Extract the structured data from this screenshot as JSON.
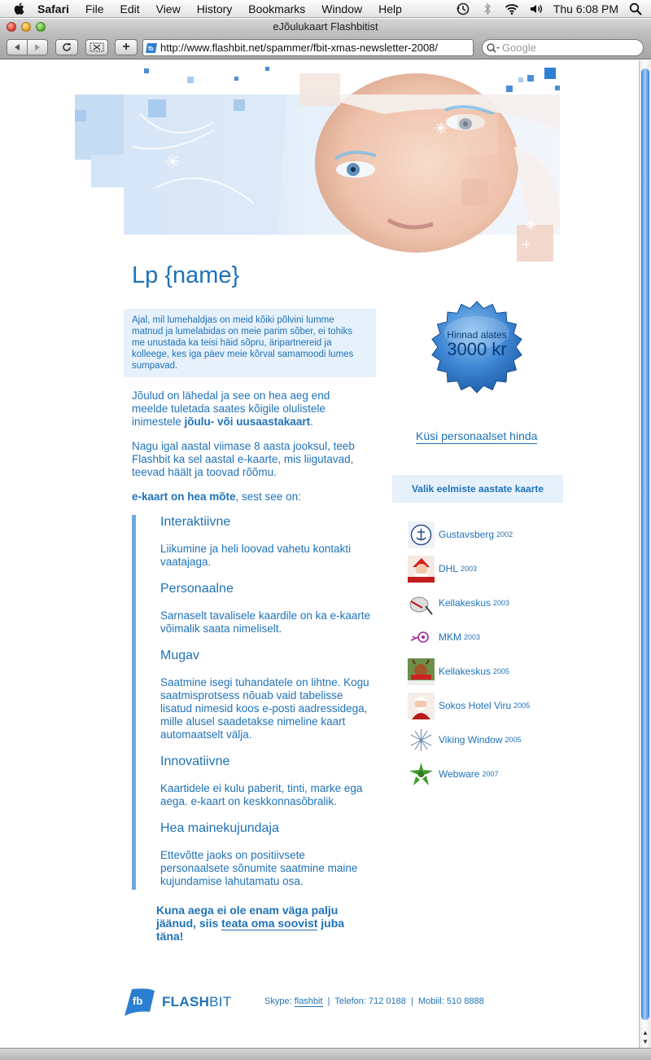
{
  "menubar": {
    "app": "Safari",
    "items": [
      "File",
      "Edit",
      "View",
      "History",
      "Bookmarks",
      "Window",
      "Help"
    ],
    "clock": "Thu 6:08 PM"
  },
  "window": {
    "title": "eJõulukaart Flashbitist",
    "url": "http://www.flashbit.net/spammer/fbit-xmas-newsletter-2008/",
    "search_placeholder": "Google",
    "add_label": "+"
  },
  "page": {
    "greeting": "Lp {name}",
    "intro": "Ajal, mil lumehaldjas on meid kõiki põlvini lumme matnud ja lumelabidas on meie parim sõber, ei tohiks me unustada ka teisi häid sõpru, äripartnereid ja kolleege, kes iga päev meie kõrval samamoodi lumes sumpavad.",
    "para1_a": "Jõulud on lähedal ja see on hea aeg end meelde tuletada saates kõigile olulistele inimestele ",
    "para1_b": "jõulu- või uusaastakaart",
    "para1_c": ".",
    "para2": "Nagu igal aastal viimase 8 aasta jooksul, teeb Flashbit ka sel aastal e-kaarte, mis liigutavad, teevad häält ja toovad rõõmu.",
    "para3_a": "e-kaart on hea mõte",
    "para3_b": ", sest see on:",
    "features": [
      {
        "title": "Interaktiivne",
        "desc": "Liikumine ja heli loovad vahetu kontakti vaatajaga."
      },
      {
        "title": "Personaalne",
        "desc": "Sarnaselt tavalisele kaardile on ka e-kaarte võimalik saata nimeliselt."
      },
      {
        "title": "Mugav",
        "desc": "Saatmine isegi tuhandatele on lihtne. Kogu saatmisprotsess nõuab vaid tabelisse lisatud nimesid koos e-posti aadressidega, mille alusel saadetakse nimeline kaart automaatselt välja."
      },
      {
        "title": "Innovatiivne",
        "desc": "Kaartidele ei kulu paberit, tinti, marke ega aega. e-kaart on keskkonnasõbralik."
      },
      {
        "title": "Hea mainekujundaja",
        "desc": "Ettevõtte jaoks on positiivsete personaalsete sõnumite saatmine maine kujundamise lahutamatu osa."
      }
    ],
    "cta_a": "Kuna aega ei ole enam väga palju jäänud, siis ",
    "cta_link": "teata oma soovist",
    "cta_b": " juba täna!",
    "price_line1": "Hinnad alates",
    "price_line2": "3000 kr",
    "ask_price": "Küsi personaalset hinda",
    "cards_heading": "Valik eelmiste aastate kaarte",
    "cards": [
      {
        "name": "Gustavsberg",
        "year": "2002"
      },
      {
        "name": "DHL",
        "year": "2003"
      },
      {
        "name": "Kellakeskus",
        "year": "2003"
      },
      {
        "name": "MKM",
        "year": "2003"
      },
      {
        "name": "Kellakeskus",
        "year": "2005"
      },
      {
        "name": "Sokos Hotel Viru",
        "year": "2005"
      },
      {
        "name": "Viking Window",
        "year": "2005"
      },
      {
        "name": "Webware",
        "year": "2007"
      }
    ],
    "footer": {
      "logo_mark": "fb",
      "brand_a": "FLASH",
      "brand_b": "BIT",
      "skype_label": "Skype: ",
      "skype_link": "flashbit",
      "phone": "  |  Telefon: 712 0188  |  Mobiil: 510 8888"
    }
  },
  "colors": {
    "text_blue": "#1f72b8",
    "box_bg": "#e6f1fb",
    "accent_bar": "#6da7e0"
  }
}
